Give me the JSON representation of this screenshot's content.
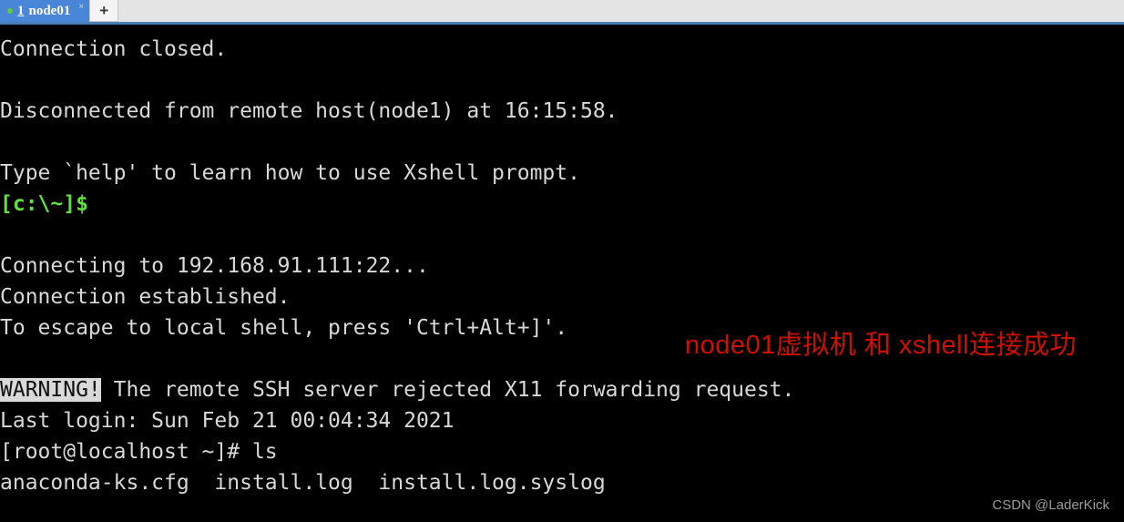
{
  "window": {
    "app_name": "Xshell",
    "accent_blue": "#4a86d8",
    "tabbar_bg": "#e4e4e4",
    "terminal_bg": "#000000",
    "terminal_fg": "#d8d8d8",
    "prompt_green": "#5fe33a",
    "annotation_red": "#cc1100",
    "status_dot_green": "#5fcb38"
  },
  "tabbar": {
    "tabs": [
      {
        "index": "1",
        "title": "node01",
        "close_label": "×",
        "status_icon": "connected-dot-icon",
        "active": true
      }
    ],
    "new_tab_label": "+"
  },
  "terminal": {
    "lines": [
      {
        "text": "Connection closed.",
        "style": "normal"
      },
      {
        "text": "",
        "style": "blank"
      },
      {
        "text": "Disconnected from remote host(node1) at 16:15:58.",
        "style": "normal"
      },
      {
        "text": "",
        "style": "blank"
      },
      {
        "text": "Type `help' to learn how to use Xshell prompt.",
        "style": "normal"
      },
      {
        "text": "[c:\\~]$",
        "style": "prompt"
      },
      {
        "text": "",
        "style": "blank"
      },
      {
        "text": "Connecting to 192.168.91.111:22...",
        "style": "normal"
      },
      {
        "text": "Connection established.",
        "style": "normal"
      },
      {
        "text": "To escape to local shell, press 'Ctrl+Alt+]'.",
        "style": "normal"
      },
      {
        "text": "",
        "style": "blank"
      },
      {
        "text": "",
        "style": "warning",
        "chip": "WARNING!",
        "rest": " The remote SSH server rejected X11 forwarding request."
      },
      {
        "text": "Last login: Sun Feb 21 00:04:34 2021",
        "style": "normal"
      },
      {
        "text": "[root@localhost ~]# ls",
        "style": "normal"
      },
      {
        "text": "anaconda-ks.cfg  install.log  install.log.syslog",
        "style": "normal"
      }
    ],
    "warning_chip_label": "WARNING!",
    "warning_rest_text": " The remote SSH server rejected X11 forwarding request."
  },
  "annotation": {
    "text": "node01虚拟机 和 xshell连接成功"
  },
  "watermark": {
    "text": "CSDN @LaderKick"
  }
}
